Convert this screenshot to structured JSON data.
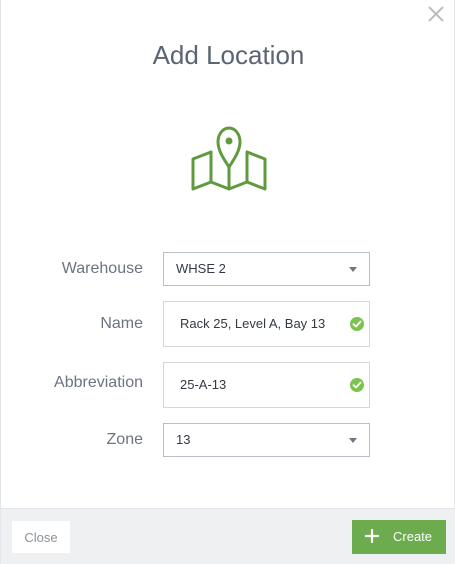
{
  "dialog": {
    "title": "Add Location",
    "icon": "map-pin-icon",
    "accent_color": "#5f9a3d"
  },
  "form": {
    "warehouse": {
      "label": "Warehouse",
      "value": "WHSE 2"
    },
    "name": {
      "label": "Name",
      "value": "Rack 25, Level A, Bay 13",
      "valid": true
    },
    "abbreviation": {
      "label": "Abbreviation",
      "value": "25-A-13",
      "valid": true
    },
    "zone": {
      "label": "Zone",
      "value": "13"
    }
  },
  "footer": {
    "close_label": "Close",
    "create_label": "Create",
    "create_color": "#6dab4f"
  }
}
